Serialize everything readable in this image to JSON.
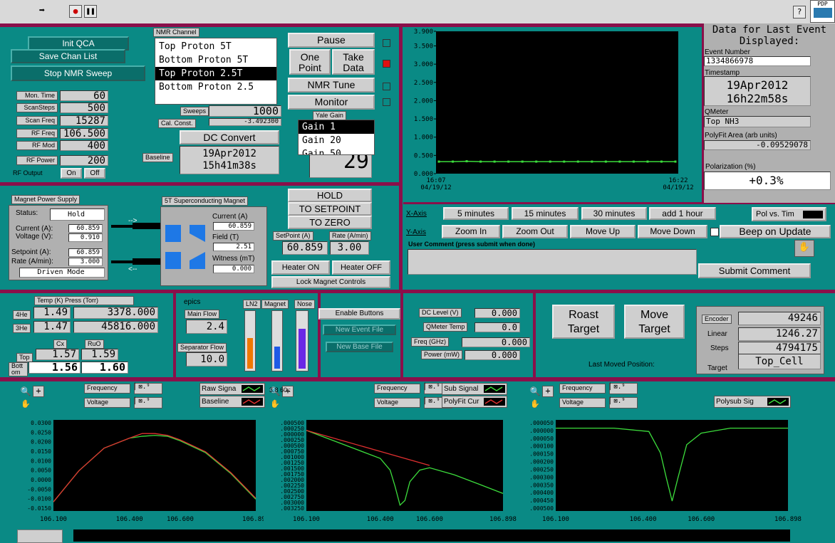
{
  "toolbar": {
    "title_partial": "",
    "help_icon": "?",
    "corner_label": "PDP"
  },
  "top_left": {
    "init_qca": "Init QCA",
    "save_chan_list": "Save Chan List",
    "stop_nmr_sweep": "Stop NMR Sweep",
    "fields": [
      {
        "label": "Mon. Time",
        "value": "60"
      },
      {
        "label": "ScanSteps",
        "value": "500"
      },
      {
        "label": "Scan Freq",
        "value": "15287"
      },
      {
        "label": "RF Freq",
        "value": "106.500"
      },
      {
        "label": "RF Mod",
        "value": "400"
      },
      {
        "label": "RF Power",
        "value": "200"
      }
    ],
    "rf_output_label": "RF Output",
    "rf_on": "On",
    "rf_off": "Off"
  },
  "nmr_channel": {
    "label": "NMR Channel",
    "items": [
      "Top Proton 5T",
      "Bottom Proton 5T",
      "Top Proton 2.5T",
      "Bottom Proton 2.5"
    ],
    "selected_index": 2,
    "sweeps_label": "Sweeps",
    "sweeps_value": "1000",
    "cal_label": "Cal. Const.",
    "cal_value": "-3.492300",
    "dc_convert": "DC Convert",
    "baseline_label": "Baseline",
    "baseline_date": "19Apr2012",
    "baseline_time": "15h41m38s"
  },
  "controls": {
    "pause": "Pause",
    "one_point_1": "One",
    "one_point_2": "Point",
    "take_data_1": "Take",
    "take_data_2": "Data",
    "nmr_tune": "NMR Tune",
    "monitor": "Monitor",
    "yale_gain_label": "Yale Gain",
    "gain_items": [
      "Gain 1",
      "Gain 20",
      "Gain 50"
    ],
    "gain_selected": 0,
    "gain_number": "29",
    "led_color": "#e01010"
  },
  "polarization_chart": {
    "x_start": "16:07",
    "x_start_date": "04/19/12",
    "x_end": "16:22",
    "x_end_date": "04/19/12",
    "y_ticks": [
      "3.900",
      "3.500",
      "3.000",
      "2.500",
      "2.000",
      "1.500",
      "1.000",
      "0.500",
      "0.000"
    ]
  },
  "event": {
    "title_1": "Data for Last Event",
    "title_2": "Displayed:",
    "event_number_label": "Event Number",
    "event_number": "1334866978",
    "timestamp_label": "Timestamp",
    "ts_date": "19Apr2012",
    "ts_time": "16h22m58s",
    "qmeter_label": "QMeter",
    "qmeter_value": "Top NH3",
    "polyfit_label": "PolyFit Area (arb units)",
    "polyfit_value": "-0.09529078",
    "polarization_label": "Polarization (%)",
    "polarization_value": "+0.3%"
  },
  "axis_controls": {
    "xaxis_label": "X-Axis",
    "x_buttons": [
      "5 minutes",
      "15 minutes",
      "30 minutes",
      "add 1 hour"
    ],
    "pol_vs_time": "Pol vs. Tim",
    "yaxis_label": "Y-Axis",
    "y_buttons": [
      "Zoom In",
      "Zoom Out",
      "Move Up",
      "Move Down"
    ],
    "beep_label": "Beep on Update",
    "user_comment_label": "User Comment (press submit when done)",
    "submit_comment": "Submit Comment"
  },
  "magnet_supply": {
    "title": "Magnet Power Supply",
    "status_label": "Status:",
    "status_value": "Hold",
    "current_label": "Current (A):",
    "current_value": "60.859",
    "voltage_label": "Voltage (V):",
    "voltage_value": "0.910",
    "setpoint_label": "Setpoint (A):",
    "setpoint_value": "60.859",
    "rate_label": "Rate (A/min):",
    "rate_value": "3.000",
    "mode": "Driven Mode"
  },
  "sc_magnet": {
    "title": "5T Superconducting Magnet",
    "current_label": "Current (A)",
    "current_value": "60.859",
    "field_label": "Field (T)",
    "field_value": "2.51",
    "witness_label": "Witness (mT)",
    "witness_value": "0.000",
    "arrow_in": "-->",
    "arrow_out": "<--"
  },
  "magnet_controls": {
    "hold": "HOLD",
    "to_setpoint": "TO SETPOINT",
    "to_zero": "TO ZERO",
    "setpoint_label": "SetPoint (A)",
    "rate_label": "Rate (A/min)",
    "setpoint_value": "60.859",
    "rate_value": "3.00",
    "heater_on": "Heater ON",
    "heater_off": "Heater OFF",
    "lock": "Lock Magnet Controls"
  },
  "temps": {
    "header": "Temp (K) Press (Torr)",
    "he4_label": "4He",
    "he4_temp": "1.49",
    "he4_press": "3378.000",
    "he3_label": "3He",
    "he3_temp": "1.47",
    "he3_press": "45816.000",
    "cx_label": "Cx",
    "ruo_label": "RuO",
    "top_label": "Top",
    "top_cx": "1.57",
    "top_ruo": "1.59",
    "bottom_label": "Bott om",
    "bottom_cx": "1.56",
    "bottom_ruo": "1.60"
  },
  "epics": {
    "title": "epics",
    "main_flow_label": "Main Flow",
    "main_flow": "2.4",
    "sep_flow_label": "Separator Flow",
    "sep_flow": "10.0",
    "ln2_label": "LN2",
    "magnet_label": "Magnet",
    "nose_label": "Nose",
    "ln2_level": 0.55,
    "magnet_level": 0.4,
    "nose_level": 0.72
  },
  "file_buttons": {
    "enable": "Enable Buttons",
    "new_event": "New Event File",
    "new_base": "New Base File"
  },
  "dc_panel": {
    "dc_level_label": "DC Level (V)",
    "dc_level": "0.000",
    "qmeter_temp_label": "QMeter Temp",
    "qmeter_temp": "0.0",
    "freq_label": "Freq (GHz)",
    "freq": "0.000",
    "power_label": "Power (mW)",
    "power": "0.000"
  },
  "target": {
    "roast_1": "Roast",
    "roast_2": "Target",
    "move_1": "Move",
    "move_2": "Target",
    "last_moved": "Last Moved Position:",
    "encoder_label": "Encoder",
    "encoder": "49246",
    "linear_label": "Linear",
    "linear": "1246.27",
    "steps_label": "Steps",
    "steps": "4794175",
    "target_label": "Target",
    "target": "Top_Cell"
  },
  "bottom_plots": {
    "freq_label": "Frequency",
    "volt_label": "Voltage",
    "raw_signal": "Raw Signa",
    "baseline": "Baseline",
    "sub_signal": "Sub Signal",
    "polyfit": "PolyFit Cur",
    "polysub": "Polysub Sig",
    "p1_yticks": [
      "0.0300",
      "0.0250",
      "0.0200",
      "0.0150",
      "0.0100",
      "0.0050",
      "0.0000",
      "-0.0050",
      "-0.0100",
      "-0.0150"
    ],
    "p2_yticks": [
      ".000500",
      ".000250",
      ".000000",
      ".000250",
      ".000500",
      ".000750",
      ".001000",
      ".001250",
      ".001500",
      ".001750",
      ".002000",
      ".002250",
      ".002500",
      ".002750",
      ".003000",
      ".003250"
    ],
    "p3_yticks": [
      ".000050",
      ".000000",
      ".000050",
      ".000100",
      ".000150",
      ".000200",
      ".000250",
      ".000300",
      ".000350",
      ".000400",
      ".000450",
      ".000500"
    ],
    "xticks": [
      "106.100",
      "106.400",
      "106.600",
      "106.898"
    ],
    "p2_badge": "3.8 60.:"
  },
  "chart_data": [
    {
      "type": "line",
      "title": "",
      "xlabel": "",
      "ylabel": "",
      "x": [
        "16:07",
        "16:22"
      ],
      "ylim": [
        0,
        3.9
      ],
      "series": [
        {
          "values": [
            0.33,
            0.33,
            0.34,
            0.33,
            0.33,
            0.33,
            0.33,
            0.33,
            0.33,
            0.33,
            0.33,
            0.33,
            0.33,
            0.33,
            0.33,
            0.33,
            0.33,
            0.33
          ]
        }
      ]
    },
    {
      "type": "line",
      "xlim": [
        106.1,
        106.898
      ],
      "ylim": [
        -0.0175,
        0.0325
      ],
      "series": [
        {
          "name": "Raw Signa",
          "x": [
            106.1,
            106.2,
            106.3,
            106.4,
            106.45,
            106.5,
            106.55,
            106.6,
            106.7,
            106.8,
            106.898
          ],
          "values": [
            -0.0125,
            0.0045,
            0.017,
            0.0225,
            0.0235,
            0.024,
            0.0235,
            0.021,
            0.0145,
            0.003,
            -0.011
          ]
        },
        {
          "name": "Baseline",
          "x": [
            106.1,
            106.2,
            106.3,
            106.4,
            106.45,
            106.5,
            106.55,
            106.6,
            106.7,
            106.8,
            106.898
          ],
          "values": [
            -0.0125,
            0.0045,
            0.017,
            0.0225,
            0.025,
            0.025,
            0.024,
            0.0215,
            0.015,
            0.0035,
            -0.0105
          ]
        }
      ]
    },
    {
      "type": "line",
      "xlim": [
        106.1,
        106.898
      ],
      "ylim": [
        -0.00335,
        0.00055
      ],
      "series": [
        {
          "name": "Sub Signal",
          "x": [
            106.1,
            106.2,
            106.3,
            106.4,
            106.44,
            106.46,
            106.48,
            106.5,
            106.52,
            106.56,
            106.6,
            106.7,
            106.8,
            106.898
          ],
          "values": [
            0.0001,
            -0.0003,
            -0.0007,
            -0.0011,
            -0.0016,
            -0.0023,
            -0.0031,
            -0.0029,
            -0.0021,
            -0.0016,
            -0.0015,
            -0.0018,
            -0.0022,
            -0.0026
          ]
        },
        {
          "name": "PolyFit Cur",
          "x": [
            106.1,
            106.6
          ],
          "values": [
            0.0001,
            -0.0014
          ]
        }
      ]
    },
    {
      "type": "line",
      "xlim": [
        106.1,
        106.898
      ],
      "ylim": [
        -0.0005,
        5e-05
      ],
      "series": [
        {
          "name": "Polysub Sig",
          "x": [
            106.1,
            106.3,
            106.42,
            106.46,
            106.48,
            106.5,
            106.52,
            106.55,
            106.6,
            106.7,
            106.8,
            106.898
          ],
          "values": [
            0.0,
            0.0,
            -2e-05,
            -0.00015,
            -0.0003,
            -0.00044,
            -0.0003,
            -0.0001,
            -3e-05,
            0.0,
            0.0,
            0.0
          ]
        }
      ]
    }
  ]
}
